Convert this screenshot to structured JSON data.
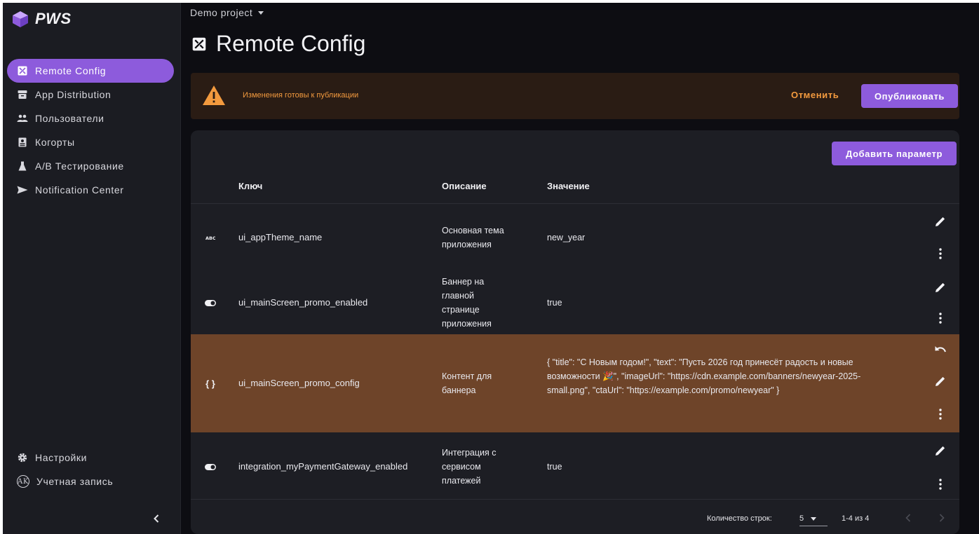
{
  "app": {
    "name": "PWS"
  },
  "sidebar": {
    "items": [
      {
        "label": "Remote Config",
        "icon": "remote-config-icon",
        "active": true
      },
      {
        "label": "App Distribution",
        "icon": "archive-icon"
      },
      {
        "label": "Пользователи",
        "icon": "users-icon"
      },
      {
        "label": "Когорты",
        "icon": "cohorts-icon"
      },
      {
        "label": "A/B Тестирование",
        "icon": "flask-icon"
      },
      {
        "label": "Notification Center",
        "icon": "send-icon"
      }
    ],
    "bottom": [
      {
        "label": "Настройки",
        "icon": "gear-icon"
      },
      {
        "label": "Учетная запись",
        "icon": "avatar-icon",
        "avatar_text": "AK"
      }
    ]
  },
  "header": {
    "project": "Demo project",
    "title": "Remote Config"
  },
  "alert": {
    "text": "Изменения готовы к публикации",
    "cancel": "Отменить",
    "publish": "Опубликовать"
  },
  "table": {
    "add_button": "Добавить параметр",
    "columns": {
      "key": "Ключ",
      "description": "Описание",
      "value": "Значение"
    },
    "rows": [
      {
        "type": "string",
        "key": "ui_appTheme_name",
        "description": "Основная тема приложения",
        "value": "new_year",
        "changed": false
      },
      {
        "type": "boolean",
        "key": "ui_mainScreen_promo_enabled",
        "description": "Баннер на главной странице приложения",
        "value": "true",
        "changed": false
      },
      {
        "type": "json",
        "key": "ui_mainScreen_promo_config",
        "description": "Контент для баннера",
        "value": "{ \"title\": \"С Новым годом!\", \"text\": \"Пусть 2026 год принесёт радость и новые возможности 🎉\", \"imageUrl\": \"https://cdn.example.com/banners/newyear-2025-small.png\", \"ctaUrl\": \"https://example.com/promo/newyear\" }",
        "changed": true
      },
      {
        "type": "boolean",
        "key": "integration_myPaymentGateway_enabled",
        "description": "Интеграция с сервисом платежей",
        "value": "true",
        "changed": false
      }
    ],
    "pagination": {
      "rows_label": "Количество строк:",
      "rows_per_page": "5",
      "range": "1-4 из 4"
    }
  },
  "colors": {
    "accent": "#8d5bdc",
    "warning": "#f39a3e",
    "changed_row": "#6e4429",
    "background": "#0d0d12"
  }
}
